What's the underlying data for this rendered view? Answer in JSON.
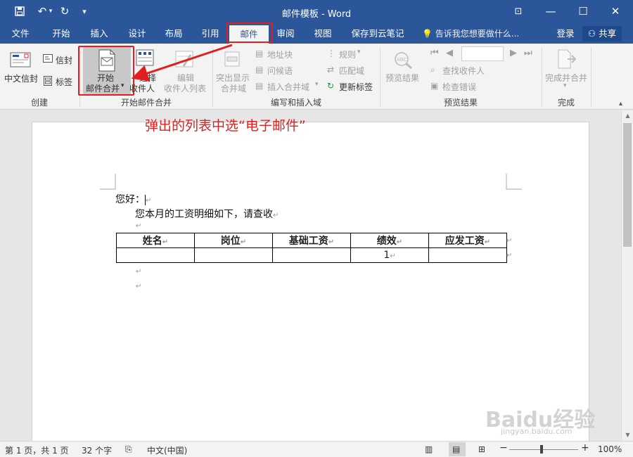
{
  "window": {
    "title": "邮件模板 - Word"
  },
  "tabs": [
    {
      "label": "文件"
    },
    {
      "label": "开始"
    },
    {
      "label": "插入"
    },
    {
      "label": "设计"
    },
    {
      "label": "布局"
    },
    {
      "label": "引用"
    },
    {
      "label": "邮件"
    },
    {
      "label": "审阅"
    },
    {
      "label": "视图"
    },
    {
      "label": "保存到云笔记"
    }
  ],
  "tell_me": "告诉我您想要做什么...",
  "account": {
    "login": "登录",
    "share": "共享"
  },
  "ribbon": {
    "create": {
      "label": "创建",
      "chinese_envelope": "中文信封",
      "envelope": "信封",
      "labels": "标签"
    },
    "start_merge": {
      "label": "开始邮件合并",
      "start_line1": "开始",
      "start_line2": "邮件合并",
      "select_line1": "选择",
      "select_line2": "收件人",
      "edit_line1": "编辑",
      "edit_line2": "收件人列表"
    },
    "write_insert": {
      "label": "编写和插入域",
      "highlight_line1": "突出显示",
      "highlight_line2": "合并域",
      "address_block": "地址块",
      "greeting": "问候语",
      "insert_field": "插入合并域",
      "rules": "规则",
      "match_fields": "匹配域",
      "update_labels": "更新标签"
    },
    "preview": {
      "label": "预览结果",
      "preview_results": "预览结果",
      "find_recipient": "查找收件人",
      "check_errors": "检查错误"
    },
    "finish": {
      "label": "完成",
      "finish_merge": "完成并合并"
    }
  },
  "annotation": "弹出的列表中选“电子邮件”",
  "document": {
    "greeting": "您好：",
    "body": "您本月的工资明细如下，请查收",
    "table": {
      "headers": [
        "姓名",
        "岗位",
        "基础工资",
        "绩效",
        "应发工资"
      ],
      "rows": [
        [
          "",
          "",
          "",
          "1",
          ""
        ]
      ]
    }
  },
  "status": {
    "page": "第 1 页，共 1 页",
    "words": "32 个字",
    "language": "中文(中国)",
    "zoom": "100%"
  },
  "watermark": {
    "brand": "Baidu经验",
    "url": "jingyan.baidu.com"
  }
}
